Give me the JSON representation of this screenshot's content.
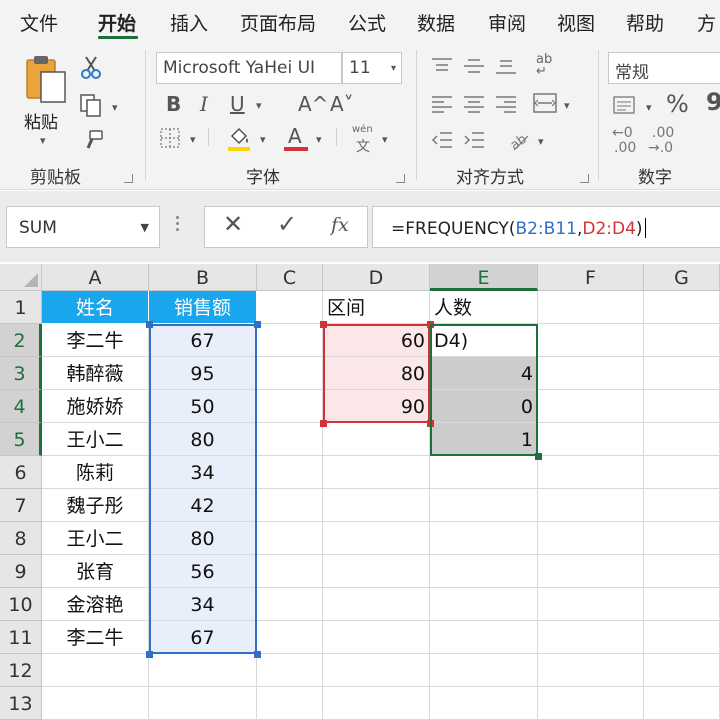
{
  "menu": {
    "tabs": [
      "文件",
      "开始",
      "插入",
      "页面布局",
      "公式",
      "数据",
      "审阅",
      "视图",
      "帮助",
      "方"
    ],
    "active": "开始"
  },
  "ribbon": {
    "clipboard": {
      "paste_label": "粘贴",
      "group_label": "剪贴板"
    },
    "font": {
      "font_name": "Microsoft YaHei UI",
      "font_size": "11",
      "bold": "B",
      "italic": "I",
      "underline": "U",
      "grow": "A^",
      "shrink": "A˅",
      "font_color_glyph": "A",
      "phonetic_top": "wén",
      "phonetic_bottom": "文",
      "group_label": "字体"
    },
    "alignment": {
      "wrap_label": "ab",
      "group_label": "对齐方式"
    },
    "number": {
      "format": "常规",
      "percent": "%",
      "comma": "9",
      "increase_decimal_top": "←0",
      "increase_decimal_bottom": ".00",
      "decrease_decimal_top": ".00",
      "decrease_decimal_bottom": "→.0",
      "group_label": "数字"
    }
  },
  "formula_bar": {
    "name_box": "SUM",
    "cancel": "✕",
    "enter": "✓",
    "fx": "fx",
    "formula_prefix": "=FREQUENCY(",
    "ref1": "B2:B11",
    "comma": ",",
    "ref2": "D2:D4",
    "formula_suffix": ")"
  },
  "sheet": {
    "columns": [
      "A",
      "B",
      "C",
      "D",
      "E",
      "F",
      "G"
    ],
    "rows": [
      "1",
      "2",
      "3",
      "4",
      "5",
      "6",
      "7",
      "8",
      "9",
      "10",
      "11",
      "12",
      "13"
    ],
    "selected_column": "E",
    "selected_rows": [
      "2",
      "3",
      "4",
      "5"
    ],
    "headers": {
      "name": "姓名",
      "sales": "销售额",
      "interval": "区间",
      "count": "人数"
    },
    "names": [
      "李二牛",
      "韩醉薇",
      "施娇娇",
      "王小二",
      "陈莉",
      "魏子彤",
      "王小二",
      "张育",
      "金溶艳",
      "李二牛"
    ],
    "sales": [
      "67",
      "95",
      "50",
      "80",
      "34",
      "42",
      "80",
      "56",
      "34",
      "67"
    ],
    "intervals": [
      "60",
      "80",
      "90"
    ],
    "counts": [
      "D4)",
      "4",
      "0",
      "1"
    ]
  },
  "colors": {
    "header_fill": "#1aa6ec",
    "ref_blue": "#2f6fc4",
    "ref_red": "#d13438",
    "accent_green": "#1e6f3c"
  }
}
